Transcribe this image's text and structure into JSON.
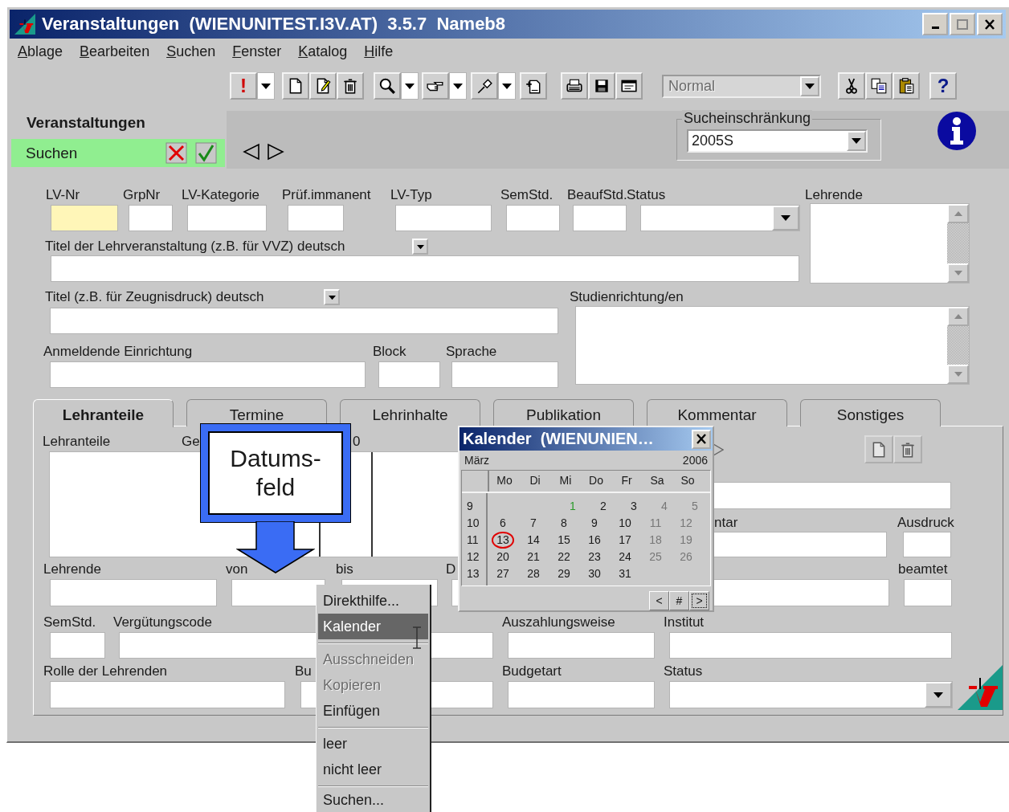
{
  "window": {
    "title": "Veranstaltungen  (WIENUNITEST.I3V.AT)  3.5.7  Nameb8"
  },
  "menu": [
    "Ablage",
    "Bearbeiten",
    "Suchen",
    "Fenster",
    "Katalog",
    "Hilfe"
  ],
  "toolbar": {
    "alert_button": "!",
    "mode_combo": {
      "value": "Normal",
      "disabled": true
    },
    "help_button": "?"
  },
  "module": {
    "title": "Veranstaltungen",
    "mode": "Suchen"
  },
  "search_restriction": {
    "label": "Sucheinschränkung",
    "value": "2005S"
  },
  "form": {
    "row_1": [
      {
        "label": "LV-Nr",
        "kind": "text",
        "highlighted": true
      },
      {
        "label": "GrpNr",
        "kind": "text",
        "highlighted": false
      },
      {
        "label": "LV-Kategorie",
        "kind": "text",
        "highlighted": false
      },
      {
        "label": "Prüf.immanent",
        "kind": "text",
        "highlighted": false
      },
      {
        "label": "LV-Typ",
        "kind": "text",
        "highlighted": false
      },
      {
        "label": "SemStd.",
        "kind": "text",
        "highlighted": false
      },
      {
        "label": "BeaufStd.",
        "kind": "text",
        "highlighted": false
      },
      {
        "label": "Status",
        "kind": "dropdown",
        "highlighted": false
      }
    ],
    "lehrende": {
      "label": "Lehrende"
    },
    "titel_vvz": {
      "label": "Titel der Lehrveranstaltung (z.B. für VVZ) deutsch"
    },
    "titel_zeugnis": {
      "label": "Titel (z.B. für Zeugnisdruck) deutsch"
    },
    "studienrichtungen": {
      "label": "Studienrichtung/en"
    },
    "row_4": [
      {
        "label": "Anmeldende Einrichtung",
        "kind": "text"
      },
      {
        "label": "Block",
        "kind": "text"
      },
      {
        "label": "Sprache",
        "kind": "text"
      }
    ]
  },
  "tabs": [
    {
      "label": "Lehranteile",
      "selected": true
    },
    {
      "label": "Termine",
      "selected": false
    },
    {
      "label": "Lehrinhalte",
      "selected": false
    },
    {
      "label": "Publikation",
      "selected": false
    },
    {
      "label": "Kommentar",
      "selected": false
    },
    {
      "label": "Sonstiges",
      "selected": false
    }
  ],
  "tab_panel": {
    "list_headers": [
      "Lehranteile",
      "Ge",
      "0"
    ],
    "side_fields": [
      {
        "label": "ntar",
        "kind": "text"
      },
      {
        "label": "Ausdruck",
        "kind": "text"
      }
    ],
    "row_3": [
      {
        "label": "Lehrende",
        "kind": "text"
      },
      {
        "label": "von",
        "kind": "text"
      },
      {
        "label": "bis",
        "kind": "text"
      },
      {
        "label": "D",
        "kind": "text"
      },
      {
        "label": "beamtet",
        "kind": "text"
      }
    ],
    "row_4": [
      {
        "label": "SemStd.",
        "kind": "text"
      },
      {
        "label": "Vergütungscode",
        "kind": "text"
      },
      {
        "label": "Auszahlungsweise",
        "kind": "text"
      },
      {
        "label": "Institut",
        "kind": "text"
      }
    ],
    "row_5": [
      {
        "label": "Rolle der Lehrenden",
        "kind": "text"
      },
      {
        "label": "Bu",
        "kind": "text"
      },
      {
        "label": "Budgetart",
        "kind": "text"
      },
      {
        "label": "Status",
        "kind": "dropdown"
      }
    ]
  },
  "callout": {
    "text": "Datums-\nfeld"
  },
  "calendar": {
    "title": "Kalender  (WIENUNIEN…",
    "month": "März",
    "year": "2006",
    "weekdays": [
      "Mo",
      "Di",
      "Mi",
      "Do",
      "Fr",
      "Sa",
      "So"
    ],
    "weeks": [
      {
        "number": "9",
        "kind": "end",
        "days": [
          {
            "day": "1",
            "greyed": false,
            "highlighted": true,
            "circled": false
          },
          {
            "day": "2",
            "greyed": false,
            "highlighted": false,
            "circled": false
          },
          {
            "day": "3",
            "greyed": false,
            "highlighted": false,
            "circled": false
          },
          {
            "day": "4",
            "greyed": true,
            "highlighted": false,
            "circled": false
          },
          {
            "day": "5",
            "greyed": true,
            "highlighted": false,
            "circled": false
          }
        ]
      },
      {
        "number": "10",
        "kind": "start",
        "days": [
          {
            "day": "6",
            "greyed": false,
            "highlighted": false,
            "circled": false
          },
          {
            "day": "7",
            "greyed": false,
            "highlighted": false,
            "circled": false
          },
          {
            "day": "8",
            "greyed": false,
            "highlighted": false,
            "circled": false
          },
          {
            "day": "9",
            "greyed": false,
            "highlighted": false,
            "circled": false
          },
          {
            "day": "10",
            "greyed": false,
            "highlighted": false,
            "circled": false
          },
          {
            "day": "11",
            "greyed": true,
            "highlighted": false,
            "circled": false
          },
          {
            "day": "12",
            "greyed": true,
            "highlighted": false,
            "circled": false
          }
        ]
      },
      {
        "number": "11",
        "kind": "start",
        "days": [
          {
            "day": "13",
            "greyed": false,
            "highlighted": false,
            "circled": true
          },
          {
            "day": "14",
            "greyed": false,
            "highlighted": false,
            "circled": false
          },
          {
            "day": "15",
            "greyed": false,
            "highlighted": false,
            "circled": false
          },
          {
            "day": "16",
            "greyed": false,
            "highlighted": false,
            "circled": false
          },
          {
            "day": "17",
            "greyed": false,
            "highlighted": false,
            "circled": false
          },
          {
            "day": "18",
            "greyed": true,
            "highlighted": false,
            "circled": false
          },
          {
            "day": "19",
            "greyed": true,
            "highlighted": false,
            "circled": false
          }
        ]
      },
      {
        "number": "12",
        "kind": "start",
        "days": [
          {
            "day": "20",
            "greyed": false,
            "highlighted": false,
            "circled": false
          },
          {
            "day": "21",
            "greyed": false,
            "highlighted": false,
            "circled": false
          },
          {
            "day": "22",
            "greyed": false,
            "highlighted": false,
            "circled": false
          },
          {
            "day": "23",
            "greyed": false,
            "highlighted": false,
            "circled": false
          },
          {
            "day": "24",
            "greyed": false,
            "highlighted": false,
            "circled": false
          },
          {
            "day": "25",
            "greyed": true,
            "highlighted": false,
            "circled": false
          },
          {
            "day": "26",
            "greyed": true,
            "highlighted": false,
            "circled": false
          }
        ]
      },
      {
        "number": "13",
        "kind": "start",
        "days": [
          {
            "day": "27",
            "greyed": false,
            "highlighted": false,
            "circled": false
          },
          {
            "day": "28",
            "greyed": false,
            "highlighted": false,
            "circled": false
          },
          {
            "day": "29",
            "greyed": false,
            "highlighted": false,
            "circled": false
          },
          {
            "day": "30",
            "greyed": false,
            "highlighted": false,
            "circled": false
          },
          {
            "day": "31",
            "greyed": false,
            "highlighted": false,
            "circled": false
          }
        ]
      }
    ],
    "nav": [
      {
        "label": "<",
        "focused": false
      },
      {
        "label": "#",
        "focused": false
      },
      {
        "label": ">",
        "focused": true
      }
    ]
  },
  "context_menu": [
    {
      "kind": "item",
      "label": "Direkthilfe...",
      "disabled": false,
      "selected": false
    },
    {
      "kind": "item",
      "label": "Kalender",
      "disabled": false,
      "selected": true
    },
    {
      "kind": "separator"
    },
    {
      "kind": "item",
      "label": "Ausschneiden",
      "disabled": true,
      "selected": false
    },
    {
      "kind": "item",
      "label": "Kopieren",
      "disabled": true,
      "selected": false
    },
    {
      "kind": "item",
      "label": "Einfügen",
      "disabled": false,
      "selected": false
    },
    {
      "kind": "separator"
    },
    {
      "kind": "item",
      "label": "leer",
      "disabled": false,
      "selected": false
    },
    {
      "kind": "item",
      "label": "nicht leer",
      "disabled": false,
      "selected": false
    },
    {
      "kind": "separator"
    },
    {
      "kind": "item",
      "label": "Suchen...",
      "disabled": false,
      "selected": false
    }
  ]
}
